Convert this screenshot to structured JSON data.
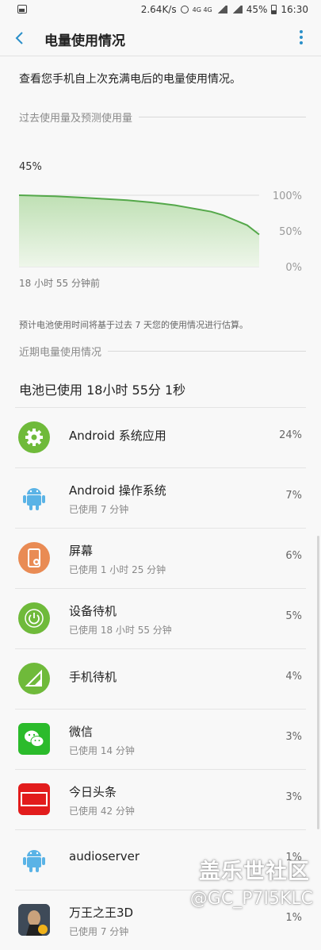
{
  "status_bar": {
    "speed": "2.64K/s",
    "network": "4G 4G",
    "battery": "45%",
    "time": "16:30"
  },
  "header": {
    "title": "电量使用情况"
  },
  "description": "查看您手机自上次充满电后的电量使用情况。",
  "section_past": "过去使用量及预测使用量",
  "chart_current": "45%",
  "chart_data": {
    "type": "area",
    "y_ticks": [
      "100%",
      "50%",
      "0%"
    ],
    "ylim": [
      0,
      100
    ],
    "x_label": "18 小时 55 分钟前",
    "values": [
      100,
      99.6,
      99,
      98.5,
      97.8,
      97,
      96,
      95,
      94,
      93,
      91.5,
      90,
      88,
      86,
      83,
      80,
      77,
      72,
      65,
      58,
      45
    ]
  },
  "estimate_note": "预计电池使用时间将基于过去 7 天您的使用情况进行估算。",
  "section_recent": "近期电量使用情况",
  "summary": "电池已使用 18小时 55分 1秒",
  "apps": [
    {
      "name": "Android 系统应用",
      "sub": "",
      "value": "24%",
      "icon": "gear-icon"
    },
    {
      "name": "Android 操作系统",
      "sub": "已使用 7 分钟",
      "value": "7%",
      "icon": "android-icon"
    },
    {
      "name": "屏幕",
      "sub": "已使用 1 小时 25 分钟",
      "value": "6%",
      "icon": "screen-icon"
    },
    {
      "name": "设备待机",
      "sub": "已使用 18 小时 55 分钟",
      "value": "5%",
      "icon": "power-icon"
    },
    {
      "name": "手机待机",
      "sub": "",
      "value": "4%",
      "icon": "signal-icon"
    },
    {
      "name": "微信",
      "sub": "已使用 14 分钟",
      "value": "3%",
      "icon": "wechat-icon"
    },
    {
      "name": "今日头条",
      "sub": "已使用 42 分钟",
      "value": "3%",
      "icon": "toutiao-icon"
    },
    {
      "name": "audioserver",
      "sub": "",
      "value": "1%",
      "icon": "android-icon"
    },
    {
      "name": "万王之王3D",
      "sub": "已使用 7 分钟",
      "value": "1%",
      "icon": "game-icon"
    }
  ],
  "watermark": {
    "line1": "盖乐世社区",
    "line2": "@GC_P7I5KLC"
  }
}
